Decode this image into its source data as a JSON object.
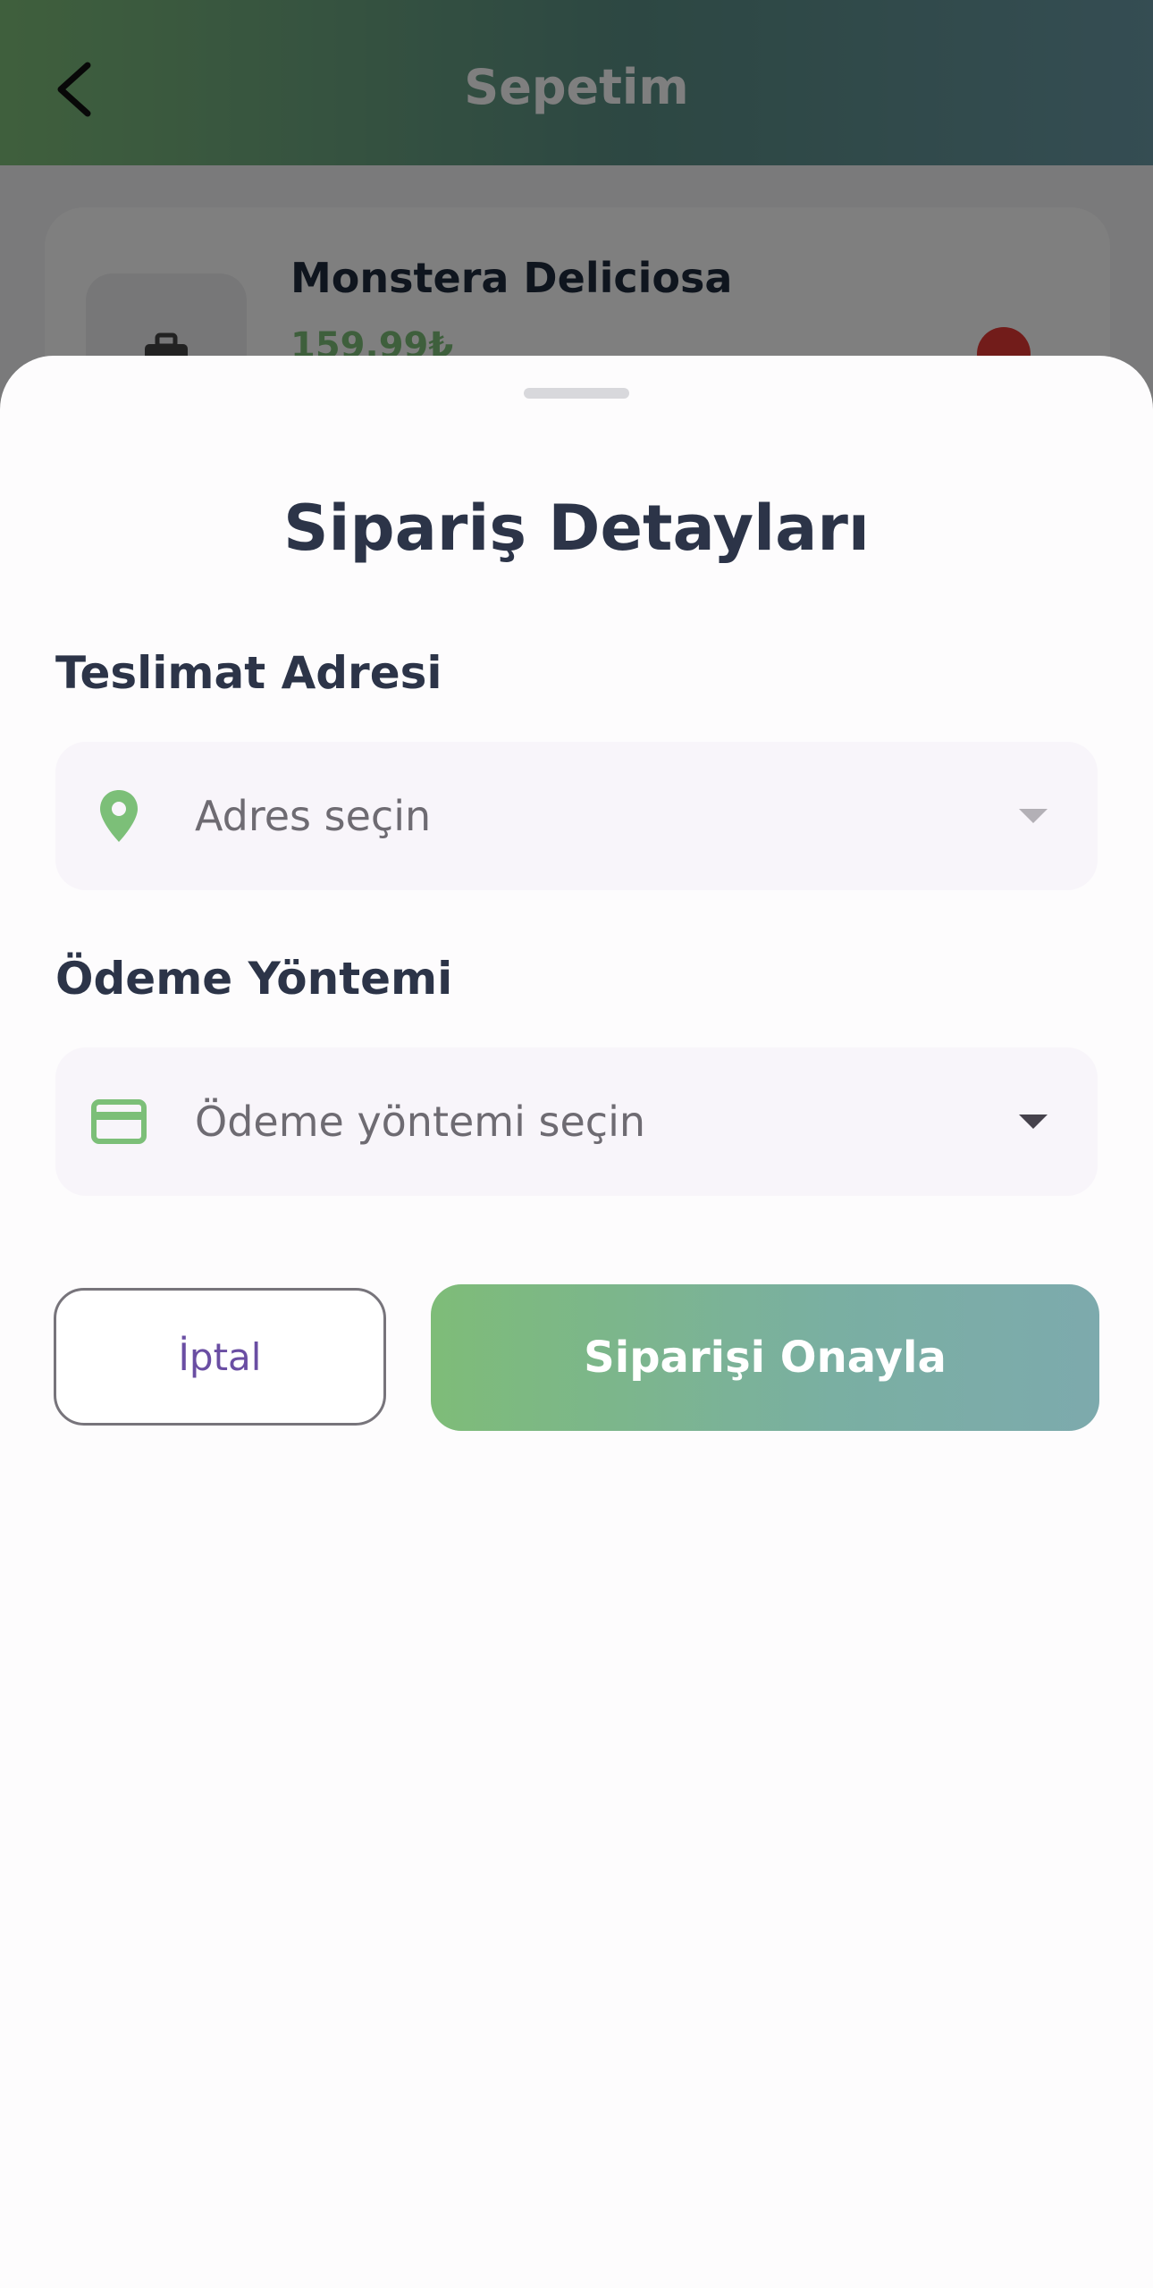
{
  "app_bar": {
    "title": "Sepetim",
    "back_icon": "chevron-left-icon"
  },
  "cart_item": {
    "name": "Monstera Deliciosa",
    "price": "159,99₺",
    "thumb_icon": "briefcase-icon",
    "delete_icon": "delete-icon"
  },
  "sheet": {
    "title": "Sipariş Detayları",
    "address_label": "Teslimat Adresi",
    "address_placeholder": "Adres seçin",
    "address_icon": "location-pin-icon",
    "payment_label": "Ödeme Yöntemi",
    "payment_placeholder": "Ödeme yöntemi seçin",
    "payment_icon": "credit-card-icon",
    "cancel_label": "İptal",
    "confirm_label": "Siparişi Onayla"
  },
  "colors": {
    "accent_green": "#7cbf78",
    "title_text": "#2c3448",
    "cancel_text": "#6a4ea3",
    "delete_red": "#e53935"
  }
}
